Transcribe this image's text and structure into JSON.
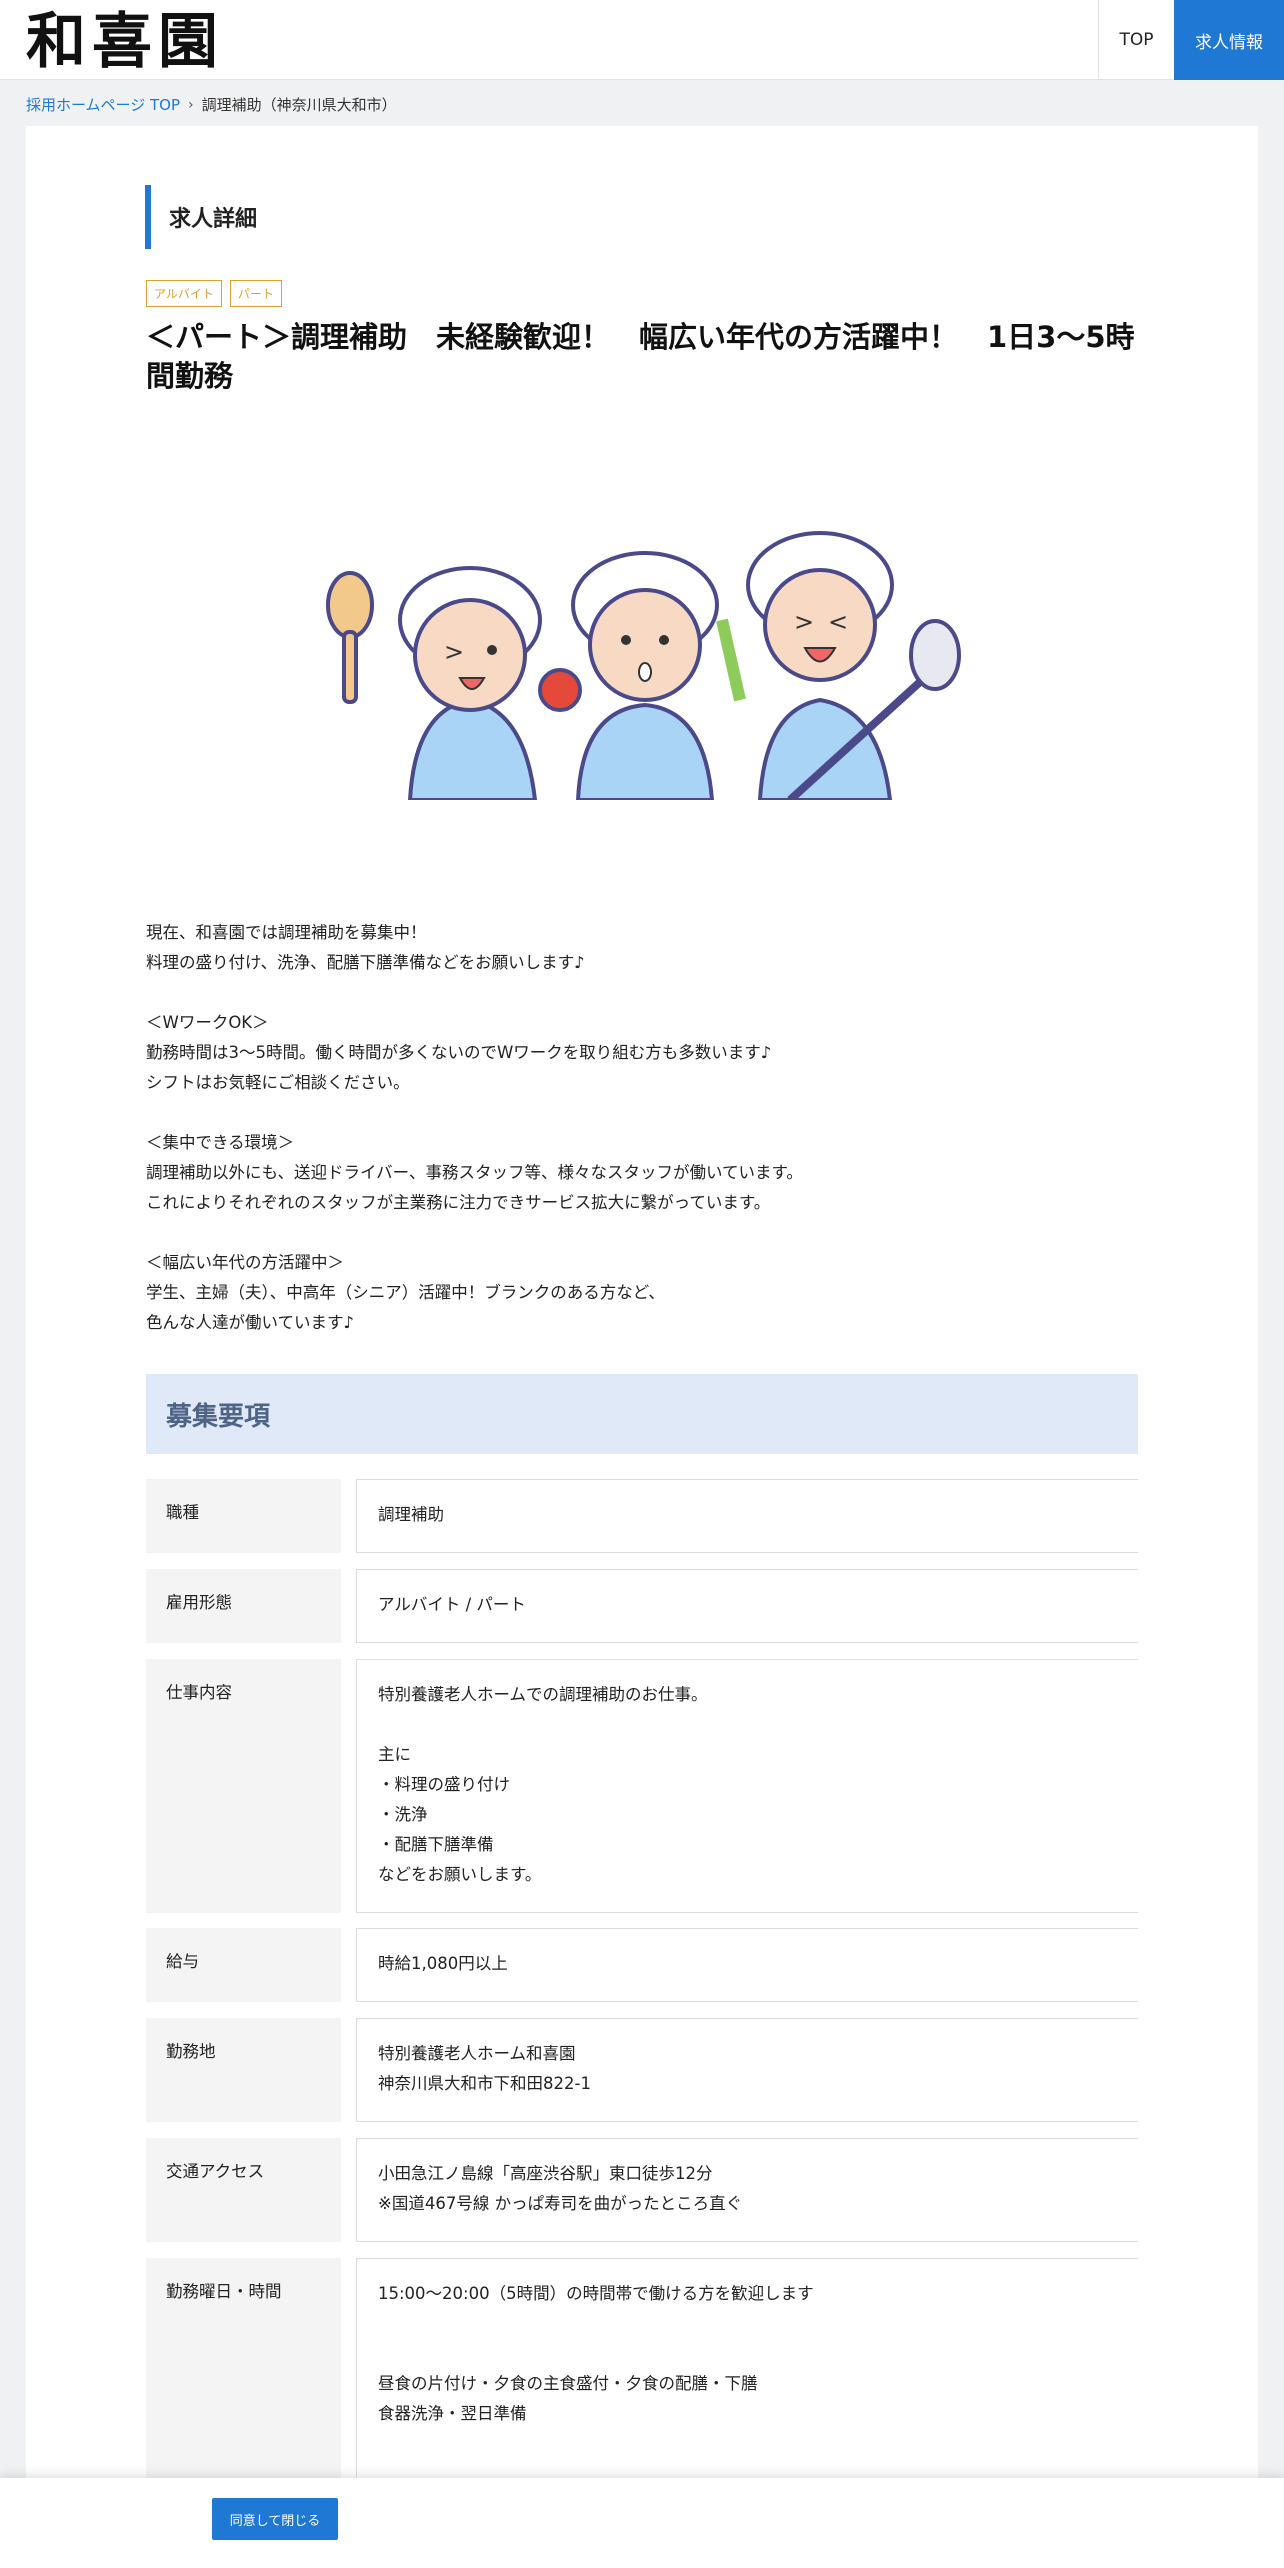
{
  "header": {
    "logo_text": "和喜園",
    "nav": {
      "top": "TOP",
      "jobs": "求人情報"
    }
  },
  "breadcrumb": {
    "home": "採用ホームページ TOP",
    "separator": "›",
    "current": "調理補助（神奈川県大和市）"
  },
  "section_heading": "求人詳細",
  "tags": [
    "アルバイト",
    "パート"
  ],
  "job_title": "＜パート＞調理補助　未経験歓迎！　幅広い年代の方活躍中！　1日3～5時間勤務",
  "illustration": {
    "icon": "kitchen-staff-illustration"
  },
  "description": "現在、和喜園では調理補助を募集中！\n料理の盛り付け、洗浄、配膳下膳準備などをお願いします♪\n\n＜WワークOK＞\n勤務時間は3～5時間。働く時間が多くないのでWワークを取り組む方も多数います♪\nシフトはお気軽にご相談ください。\n\n＜集中できる環境＞\n調理補助以外にも、送迎ドライバー、事務スタッフ等、様々なスタッフが働いています。\nこれによりそれぞれのスタッフが主業務に注力できサービス拡大に繋がっています。\n\n＜幅広い年代の方活躍中＞\n学生、主婦（夫）、中高年（シニア）活躍中！ブランクのある方など、\n色んな人達が働いています♪",
  "requirements": {
    "title": "募集要項",
    "rows": [
      {
        "label": "職種",
        "value": "調理補助"
      },
      {
        "label": "雇用形態",
        "value": "アルバイト / パート"
      },
      {
        "label": "仕事内容",
        "value": "特別養護老人ホームでの調理補助のお仕事。\n\n主に\n・料理の盛り付け\n・洗浄\n・配膳下膳準備\nなどをお願いします。"
      },
      {
        "label": "給与",
        "value": "時給1,080円以上"
      },
      {
        "label": "勤務地",
        "value": "特別養護老人ホーム和喜園\n神奈川県大和市下和田822-1"
      },
      {
        "label": "交通アクセス",
        "value": "小田急江ノ島線「高座渋谷駅」東口徒歩12分\n※国道467号線 かっぱ寿司を曲がったところ直ぐ"
      },
      {
        "label": "勤務曜日・時間",
        "value": "15:00～20:00（5時間）の時間帯で働ける方を歓迎します\n\n\n昼食の片付け・夕食の主食盛付・夕食の配膳・下膳\n食器洗浄・翌日準備\n\n\nシフトについてはお気軽にご相談してください。"
      }
    ]
  },
  "cookie_bar": {
    "button_label": "同意して閉じる"
  },
  "colors": {
    "accent": "#1e78d4",
    "tag": "#e0a030",
    "banner_bg": "#dfe9f8",
    "banner_text": "#4e6386"
  }
}
